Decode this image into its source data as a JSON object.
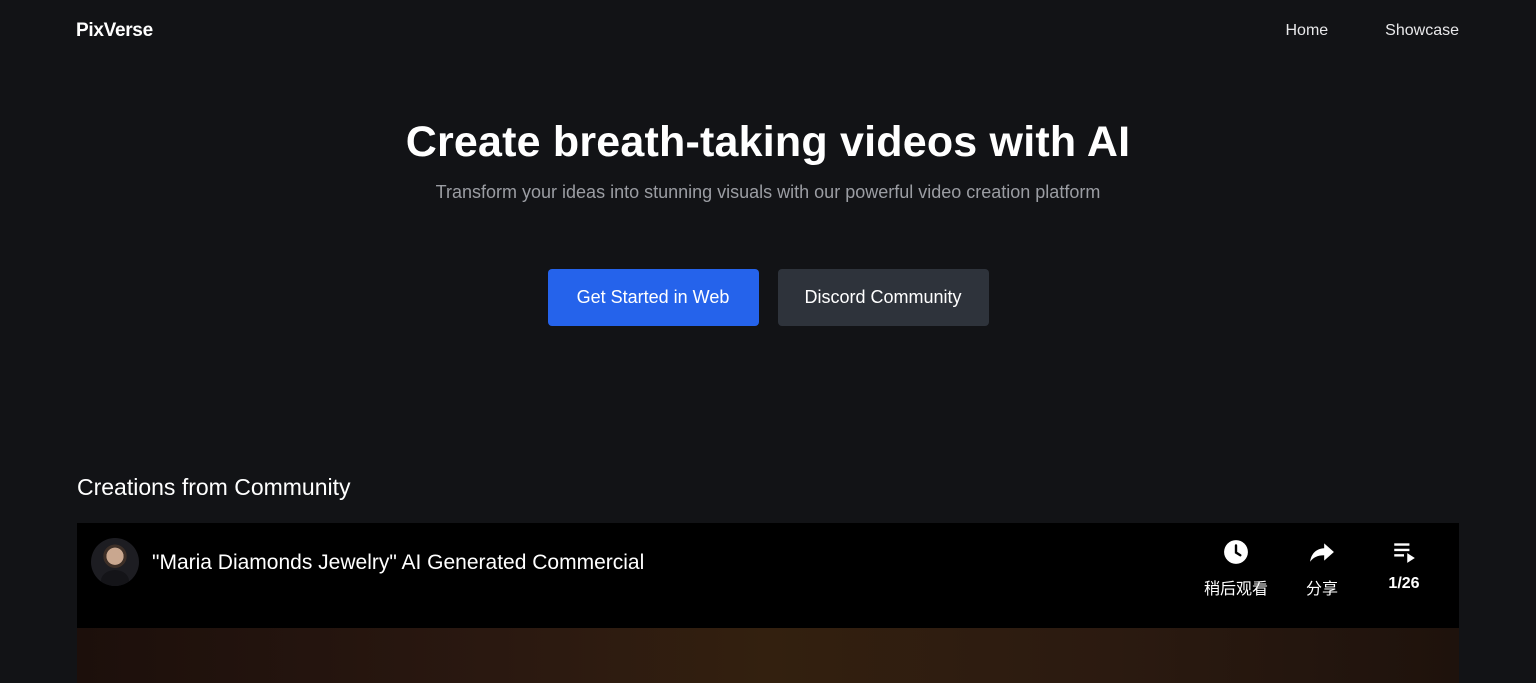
{
  "header": {
    "logo": "PixVerse",
    "nav": [
      {
        "label": "Home"
      },
      {
        "label": "Showcase"
      }
    ]
  },
  "hero": {
    "title": "Create breath-taking videos with AI",
    "subtitle": "Transform your ideas into stunning visuals with our powerful video creation platform",
    "primary_button": "Get Started in Web",
    "secondary_button": "Discord Community"
  },
  "community": {
    "title": "Creations from Community",
    "video": {
      "title": "\"Maria Diamonds Jewelry\" AI Generated Commercial",
      "watch_later_label": "稍后观看",
      "share_label": "分享",
      "playlist_position": "1/26",
      "icons": [
        "clock-icon",
        "share-icon",
        "playlist-icon"
      ]
    }
  },
  "colors": {
    "background": "#121316",
    "primary": "#2563eb",
    "secondary": "#2e333b",
    "subtitle": "#9b9da3"
  }
}
